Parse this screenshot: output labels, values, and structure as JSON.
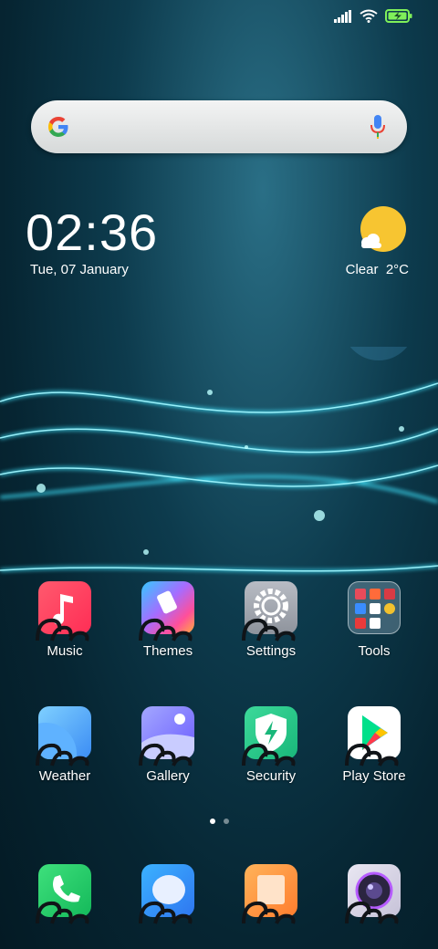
{
  "status_bar": {
    "signal_icon": "signal-icon",
    "wifi_icon": "wifi-icon",
    "battery_icon": "battery-charging-icon"
  },
  "search": {
    "logo": "google-logo-icon",
    "mic": "microphone-icon"
  },
  "clock": {
    "time": "02:36",
    "date": "Tue, 07 January"
  },
  "weather": {
    "condition": "Clear",
    "temperature": "2°C",
    "icon": "sun-cloud-icon"
  },
  "apps_row1": [
    {
      "label": "Music"
    },
    {
      "label": "Themes"
    },
    {
      "label": "Settings"
    },
    {
      "label": "Tools"
    }
  ],
  "apps_row2": [
    {
      "label": "Weather"
    },
    {
      "label": "Gallery"
    },
    {
      "label": "Security"
    },
    {
      "label": "Play Store"
    }
  ],
  "page_indicator": {
    "pages": 2,
    "current": 1
  },
  "dock": [
    {
      "icon": "phone-icon"
    },
    {
      "icon": "messages-icon"
    },
    {
      "icon": "notes-icon"
    },
    {
      "icon": "camera-icon"
    }
  ],
  "colors": {
    "accent_cyan": "#33e0ff",
    "sun": "#f7c531"
  }
}
